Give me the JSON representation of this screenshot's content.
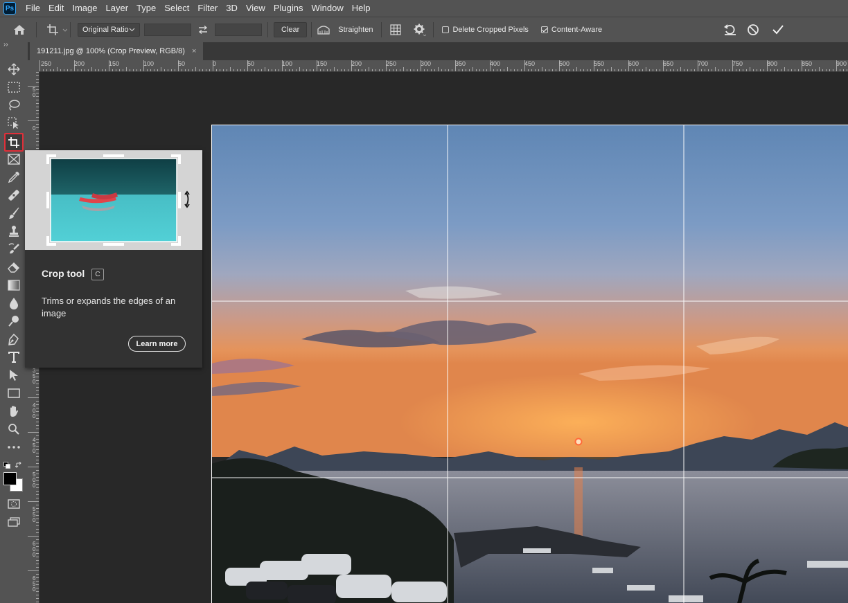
{
  "app": {
    "logo": "Ps"
  },
  "menu": [
    "File",
    "Edit",
    "Image",
    "Layer",
    "Type",
    "Select",
    "Filter",
    "3D",
    "View",
    "Plugins",
    "Window",
    "Help"
  ],
  "options": {
    "ratio": "Original Ratio",
    "clear_label": "Clear",
    "straighten_label": "Straighten",
    "delete_cropped_label": "Delete Cropped Pixels",
    "delete_cropped_checked": false,
    "content_aware_label": "Content-Aware",
    "content_aware_checked": true
  },
  "document": {
    "tab_title": "191211.jpg @ 100% (Crop Preview, RGB/8)",
    "close_glyph": "×"
  },
  "ruler": {
    "h_labels": [
      "250",
      "200",
      "150",
      "100",
      "50",
      "0",
      "50",
      "100",
      "150",
      "200",
      "250",
      "300",
      "350",
      "400",
      "450",
      "500",
      "550",
      "600",
      "650",
      "700",
      "750",
      "800",
      "850",
      "900"
    ],
    "v_labels": [
      "5\n0",
      "0",
      "3\n5\n0",
      "4\n0\n0",
      "4\n5\n0",
      "5\n0\n0",
      "5\n5\n0",
      "6\n0\n0",
      "6\n5\n0"
    ]
  },
  "tooltip": {
    "title": "Crop tool",
    "shortcut": "C",
    "description": "Trims or expands the edges of an image",
    "learn_more_label": "Learn more"
  },
  "colors": {
    "accent": "#e0303a",
    "foreground": "#000000",
    "background": "#ffffff"
  },
  "tools": [
    "move-icon",
    "marquee-icon",
    "lasso-icon",
    "object-select-icon",
    "crop-icon",
    "frame-icon",
    "eyedropper-icon",
    "healing-icon",
    "brush-icon",
    "stamp-icon",
    "history-brush-icon",
    "eraser-icon",
    "gradient-icon",
    "blur-icon",
    "dodge-icon",
    "pen-icon",
    "type-icon",
    "path-select-icon",
    "rectangle-icon",
    "hand-icon",
    "zoom-icon",
    "more-icon"
  ]
}
